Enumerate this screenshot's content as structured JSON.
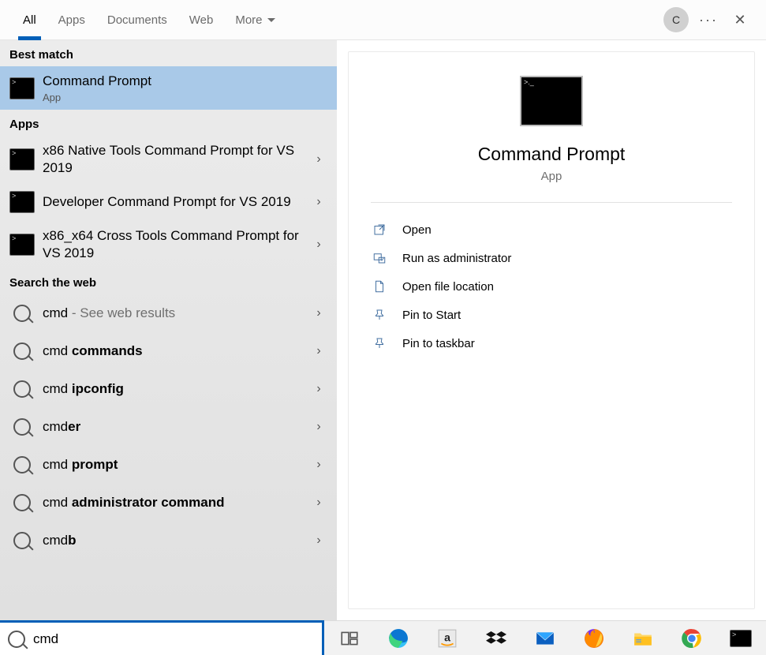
{
  "tabs": {
    "all": "All",
    "apps": "Apps",
    "documents": "Documents",
    "web": "Web",
    "more": "More"
  },
  "avatar_letter": "C",
  "sections": {
    "best_match": "Best match",
    "apps": "Apps",
    "search_web": "Search the web"
  },
  "best_match": {
    "title": "Command Prompt",
    "sub": "App"
  },
  "app_results": [
    "x86 Native Tools Command Prompt for VS 2019",
    "Developer Command Prompt for VS 2019",
    "x86_x64 Cross Tools Command Prompt for VS 2019"
  ],
  "web_results": [
    {
      "prefix": "cmd",
      "bold": "",
      "suffix": " - See web results"
    },
    {
      "prefix": "cmd ",
      "bold": "commands",
      "suffix": ""
    },
    {
      "prefix": "cmd ",
      "bold": "ipconfig",
      "suffix": ""
    },
    {
      "prefix": "cmd",
      "bold": "er",
      "suffix": ""
    },
    {
      "prefix": "cmd ",
      "bold": "prompt",
      "suffix": ""
    },
    {
      "prefix": "cmd ",
      "bold": "administrator command",
      "suffix": ""
    },
    {
      "prefix": "cmd",
      "bold": "b",
      "suffix": ""
    }
  ],
  "detail": {
    "title": "Command Prompt",
    "sub": "App",
    "actions": [
      "Open",
      "Run as administrator",
      "Open file location",
      "Pin to Start",
      "Pin to taskbar"
    ]
  },
  "search": {
    "value": "cmd"
  },
  "taskbar_icons": [
    "task-view",
    "edge",
    "amazon",
    "dropbox",
    "mail",
    "firefox",
    "file-explorer",
    "chrome",
    "cmd"
  ]
}
